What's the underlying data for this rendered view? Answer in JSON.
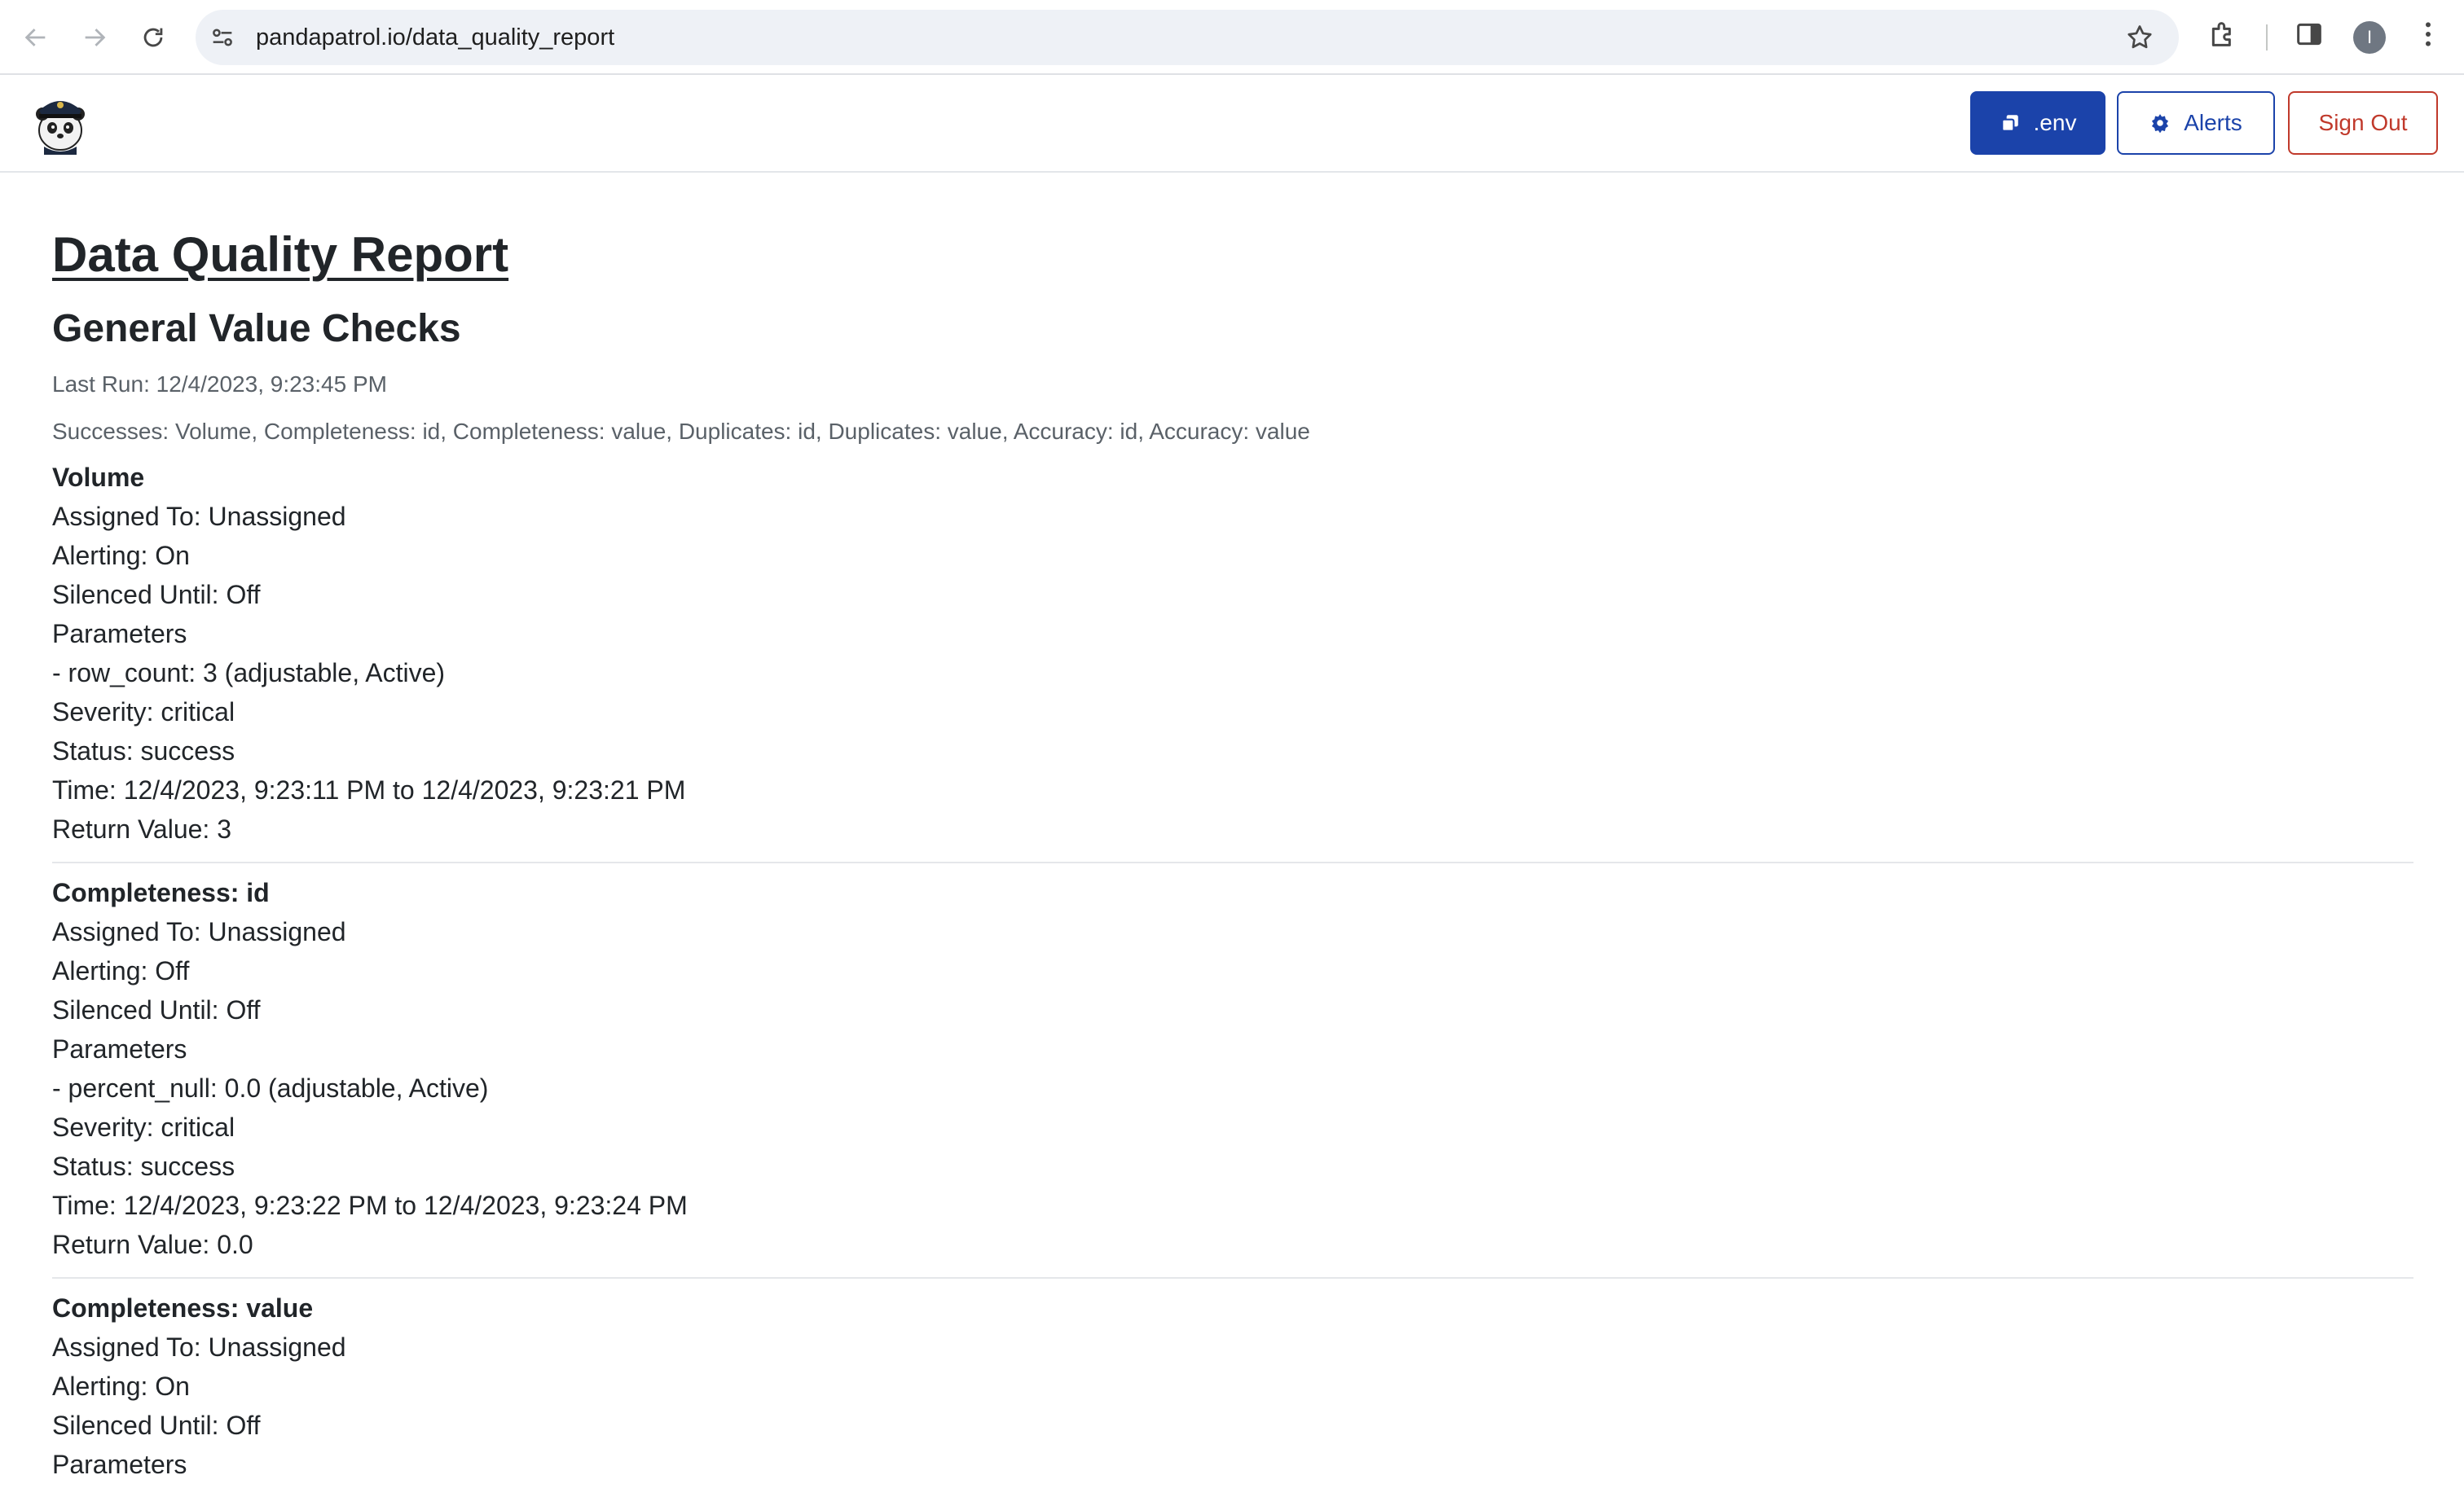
{
  "browser": {
    "url": "pandapatrol.io/data_quality_report",
    "profile_initial": "I"
  },
  "header": {
    "env_label": ".env",
    "alerts_label": "Alerts",
    "signout_label": "Sign Out",
    "colors": {
      "primary": "#1b43aa",
      "danger": "#c0392b"
    }
  },
  "report": {
    "title": "Data Quality Report",
    "section_title": "General Value Checks",
    "last_run": "Last Run: 12/4/2023, 9:23:45 PM",
    "successes": "Successes: Volume, Completeness: id, Completeness: value, Duplicates: id, Duplicates: value, Accuracy: id, Accuracy: value",
    "checks": [
      {
        "name": "Volume",
        "assigned": "Assigned To: Unassigned",
        "alerting": "Alerting: On",
        "silenced": "Silenced Until: Off",
        "parameters": "Parameters",
        "param": "- row_count: 3 (adjustable, Active)",
        "severity": "Severity: critical",
        "status": "Status: success",
        "time": "Time: 12/4/2023, 9:23:11 PM to 12/4/2023, 9:23:21 PM",
        "return_value": "Return Value: 3"
      },
      {
        "name": "Completeness: id",
        "assigned": "Assigned To: Unassigned",
        "alerting": "Alerting: Off",
        "silenced": "Silenced Until: Off",
        "parameters": "Parameters",
        "param": "- percent_null: 0.0 (adjustable, Active)",
        "severity": "Severity: critical",
        "status": "Status: success",
        "time": "Time: 12/4/2023, 9:23:22 PM to 12/4/2023, 9:23:24 PM",
        "return_value": "Return Value: 0.0"
      },
      {
        "name": "Completeness: value",
        "assigned": "Assigned To: Unassigned",
        "alerting": "Alerting: On",
        "silenced": "Silenced Until: Off",
        "parameters": "Parameters"
      }
    ]
  }
}
